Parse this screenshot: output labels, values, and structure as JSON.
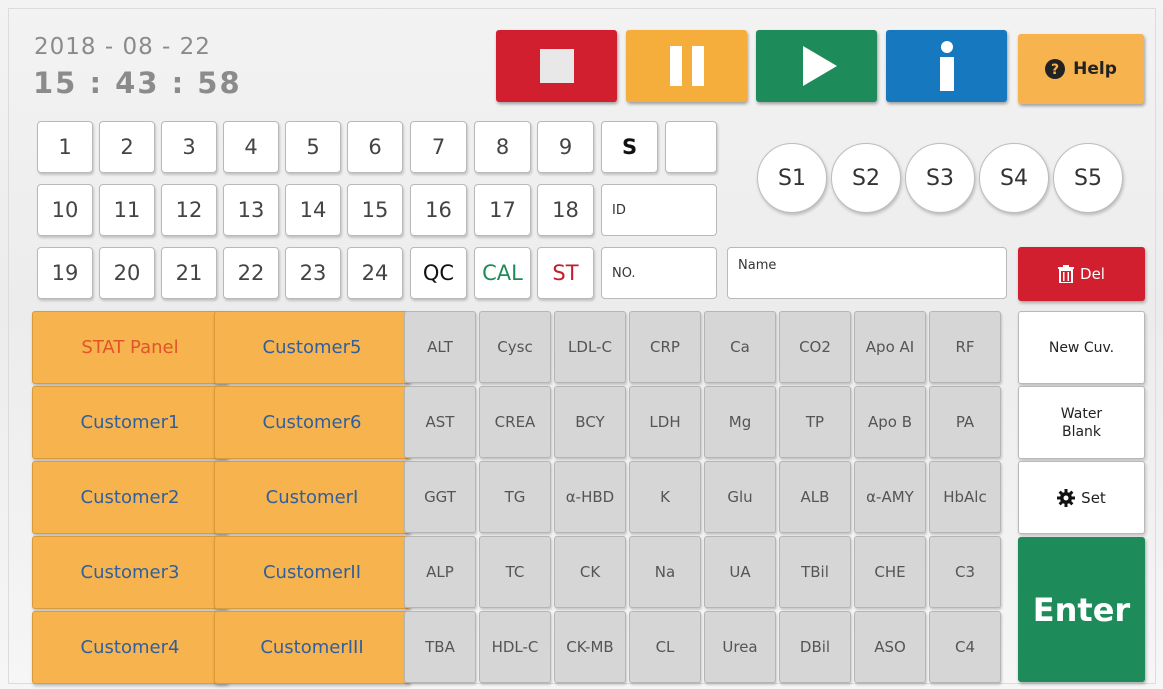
{
  "header": {
    "date": "2018 - 08 - 22",
    "time": "15 : 43 : 58"
  },
  "controls": {
    "help_label": "Help"
  },
  "samples": {
    "row1": [
      "1",
      "2",
      "3",
      "4",
      "5",
      "6",
      "7",
      "8",
      "9"
    ],
    "row2": [
      "10",
      "11",
      "12",
      "13",
      "14",
      "15",
      "16",
      "17",
      "18"
    ],
    "row3": [
      "19",
      "20",
      "21",
      "22",
      "23",
      "24"
    ],
    "s_label": "S",
    "qc": "QC",
    "cal": "CAL",
    "st": "ST",
    "id_placeholder": "ID",
    "no_placeholder": "NO.",
    "name_placeholder": "Name"
  },
  "standards": [
    "S1",
    "S2",
    "S3",
    "S4",
    "S5"
  ],
  "del_label": "Del",
  "panels": [
    [
      "STAT Panel",
      "Customer5"
    ],
    [
      "Customer1",
      "Customer6"
    ],
    [
      "Customer2",
      "CustomerI"
    ],
    [
      "Customer3",
      "CustomerII"
    ],
    [
      "Customer4",
      "CustomerIII"
    ]
  ],
  "tests": [
    [
      "ALT",
      "Cysc",
      "LDL-C",
      "CRP",
      "Ca",
      "CO2",
      "Apo AI",
      "RF"
    ],
    [
      "AST",
      "CREA",
      "BCY",
      "LDH",
      "Mg",
      "TP",
      "Apo B",
      "PA"
    ],
    [
      "GGT",
      "TG",
      "α-HBD",
      "K",
      "Glu",
      "ALB",
      "α-AMY",
      "HbAlc"
    ],
    [
      "ALP",
      "TC",
      "CK",
      "Na",
      "UA",
      "TBil",
      "CHE",
      "C3"
    ],
    [
      "TBA",
      "HDL-C",
      "CK-MB",
      "CL",
      "Urea",
      "DBil",
      "ASO",
      "C4"
    ]
  ],
  "side": {
    "new_cuv": "New Cuv.",
    "water_blank_line1": "Water",
    "water_blank_line2": "Blank",
    "set": "Set",
    "enter": "Enter"
  },
  "colors": {
    "stop": "#d11f2f",
    "pause": "#f5ae3b",
    "play": "#1d8c5a",
    "info": "#1679c0",
    "help": "#f7b34d",
    "panel": "#f7b34d",
    "qc": "#222222",
    "cal": "#1d8c5a",
    "st": "#c0202e",
    "stat": "#e0552a"
  }
}
